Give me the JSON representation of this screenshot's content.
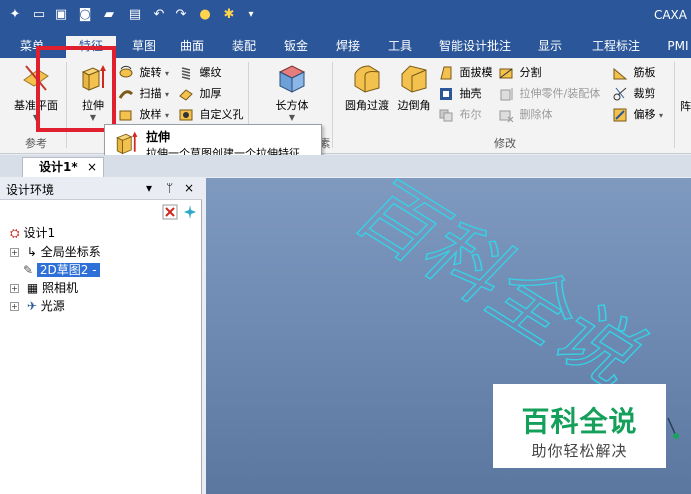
{
  "window": {
    "app_title": "CAXA"
  },
  "quick_access": {
    "icons": [
      "app-menu-icon",
      "new-file-icon",
      "open-icon",
      "capture-icon",
      "folder-icon",
      "save-icon",
      "undo-icon",
      "redo-icon",
      "bulb-icon",
      "sparkle-icon",
      "customize-icon"
    ]
  },
  "tabs": [
    "菜单",
    "特征",
    "草图",
    "曲面",
    "装配",
    "钣金",
    "焊接",
    "工具",
    "智能设计批注",
    "显示",
    "工程标注",
    "PMI"
  ],
  "active_tab": "特征",
  "ribbon": {
    "reference": {
      "datum_plane_label": "基准平面",
      "group_label": "参考"
    },
    "features": {
      "extrude_label": "拉伸",
      "revolve_label": "旋转",
      "sweep_label": "扫描",
      "loft_label": "放样",
      "thread_label": "螺纹",
      "thicken_label": "加厚",
      "custom_hole_label": "自定义孔",
      "group_label_fragment": "素"
    },
    "primitives": {
      "box_label": "长方体"
    },
    "modify": {
      "fillet_label": "圆角过渡",
      "chamfer_label": "边倒角",
      "draft_label": "面拔模",
      "shell_label": "抽壳",
      "boolean_label": "布尔",
      "split_label": "分割",
      "extrude_part_label": "拉伸零件/装配体",
      "delete_body_label": "删除体",
      "rib_label": "筋板",
      "trim_label": "裁剪",
      "offset_label": "偏移",
      "group_label": "修改"
    },
    "edge_fragment": "阵"
  },
  "tooltip": {
    "title": "拉伸",
    "description": "拉伸一个草图创建一个拉伸特征."
  },
  "document_tab": {
    "label": "设计1*",
    "close": "×"
  },
  "design_panel": {
    "title": "设计环境",
    "controls": [
      "▾",
      "ᛘ",
      "×"
    ],
    "tree": [
      {
        "label": "设计1",
        "icon": "design-root-icon",
        "expander": ""
      },
      {
        "label": "全局坐标系",
        "icon": "axes-icon",
        "expander": "+"
      },
      {
        "label": "2D草图2 -",
        "icon": "sketch-icon",
        "expander": "",
        "selected": true
      },
      {
        "label": "照相机",
        "icon": "camera-icon",
        "expander": "+"
      },
      {
        "label": "光源",
        "icon": "light-icon",
        "expander": "+"
      }
    ]
  },
  "viewport": {
    "background_color": "#6f8bb3",
    "sketch_text": "百科全说",
    "sketch_color": "#35d2e6"
  },
  "watermark": {
    "title": "百科全说",
    "subtitle": "助你轻松解决",
    "title_color": "#14a05a"
  },
  "colors": {
    "title_bar": "#2b579a",
    "highlight": "#e0202e"
  }
}
